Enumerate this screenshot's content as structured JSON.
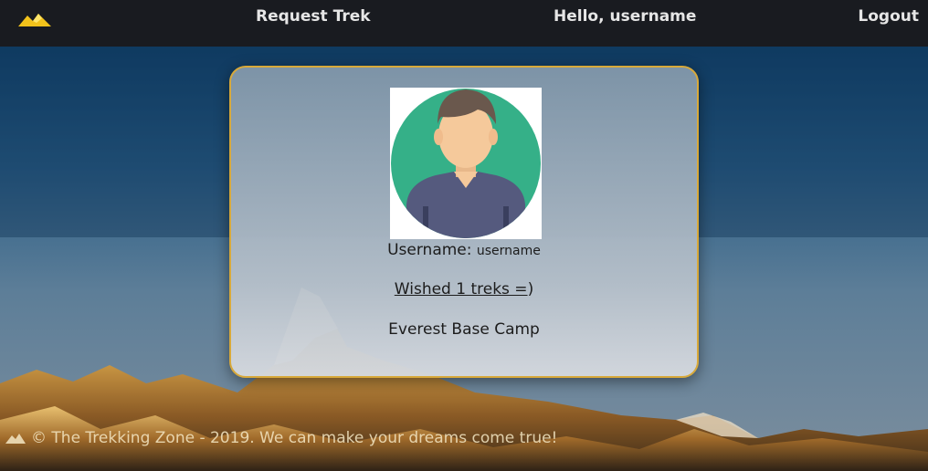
{
  "navbar": {
    "logo_icon": "mountain-logo-icon",
    "request_trek_label": "Request Trek",
    "greeting": "Hello, username",
    "logout_label": "Logout"
  },
  "profile": {
    "avatar_icon": "user-avatar-icon",
    "username_label": "Username:",
    "username_value": "username",
    "wished_text": "Wished 1 treks =",
    "wished_suffix": ")",
    "treks": [
      "Everest Base Camp"
    ]
  },
  "footer": {
    "icon": "mountain-footer-icon",
    "text": "© The Trekking Zone - 2019. We can make your dreams come true!"
  },
  "colors": {
    "navbar_bg": "#191b20",
    "card_border": "#d8a93a",
    "logo_yellow": "#f2c21b",
    "avatar_green": "#35b088",
    "avatar_shirt": "#555a7e",
    "avatar_skin": "#f5c99b",
    "avatar_hair": "#6a584d"
  }
}
